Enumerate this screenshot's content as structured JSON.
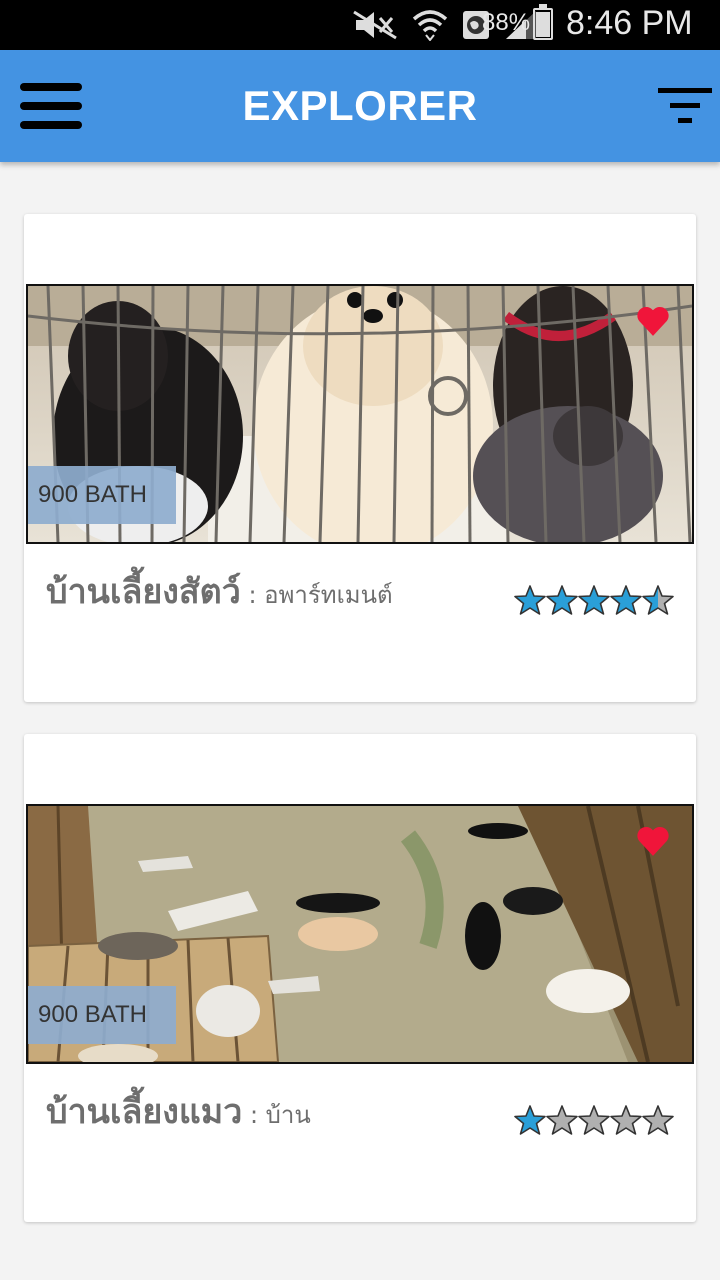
{
  "status_bar": {
    "battery_percent": "88%",
    "battery_level": 0.88,
    "time": "8:46 PM"
  },
  "app_bar": {
    "title": "EXPLORER",
    "menu_icon": "hamburger-menu-icon",
    "filter_icon": "filter-icon"
  },
  "listings": [
    {
      "price": "900 BATH",
      "name": "บ้านเลี้ยงสัตว์",
      "separator": " : ",
      "type": "อพาร์ทเมนต์",
      "rating": 4.5,
      "favorite": true,
      "photo": "dogs-in-cage-photo"
    },
    {
      "price": "900 BATH",
      "name": "บ้านเลี้ยงแมว",
      "separator": " : ",
      "type": "บ้าน",
      "rating": 1,
      "favorite": true,
      "photo": "cats-on-floor-photo"
    }
  ],
  "colors": {
    "app_bar": "#4493e2",
    "star_filled": "#2a9fd8",
    "star_empty": "#b0b0b0",
    "heart": "#f0153a",
    "price_tag": "#8eacce"
  }
}
